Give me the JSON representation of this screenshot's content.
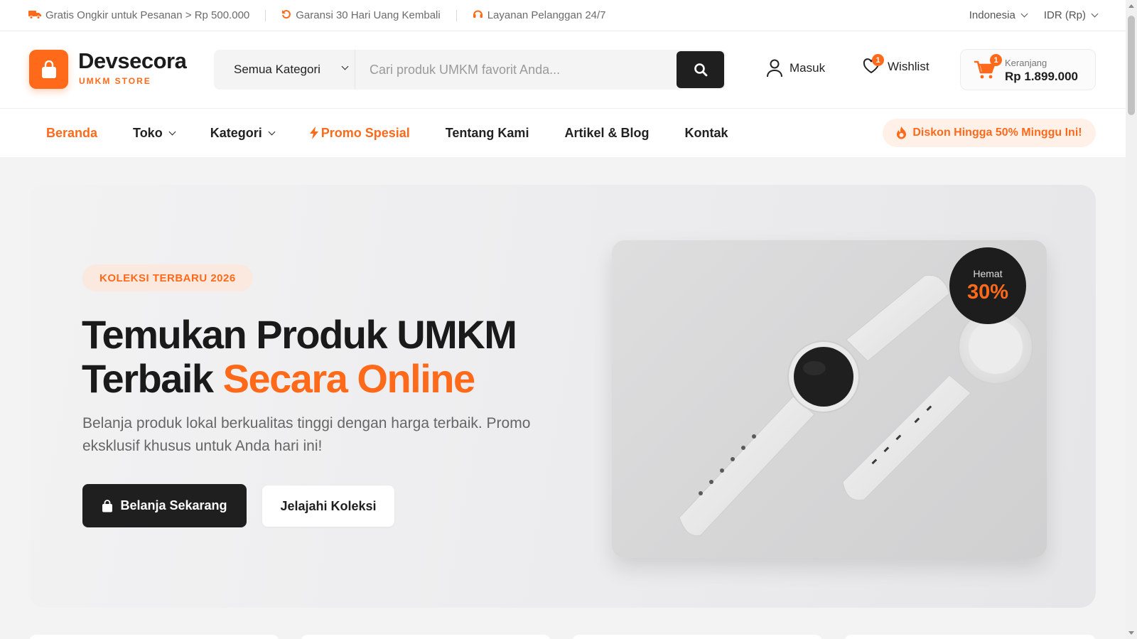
{
  "topbar": {
    "promos": [
      {
        "icon": "truck-icon",
        "text": "Gratis Ongkir untuk Pesanan > Rp 500.000"
      },
      {
        "icon": "refresh-icon",
        "text": "Garansi 30 Hari Uang Kembali"
      },
      {
        "icon": "headset-icon",
        "text": "Layanan Pelanggan 24/7"
      }
    ],
    "language": "Indonesia",
    "currency": "IDR (Rp)"
  },
  "header": {
    "logo_name": "Devsecora",
    "logo_sub": "UMKM STORE",
    "search_category": "Semua Kategori",
    "search_placeholder": "Cari produk UMKM favorit Anda...",
    "login_label": "Masuk",
    "wishlist_label": "Wishlist",
    "wishlist_count": "1",
    "cart_label": "Keranjang",
    "cart_total": "Rp 1.899.000",
    "cart_count": "1"
  },
  "nav": {
    "items": [
      {
        "label": "Beranda",
        "active": true
      },
      {
        "label": "Toko",
        "dropdown": true
      },
      {
        "label": "Kategori",
        "dropdown": true
      },
      {
        "label": "Promo Spesial",
        "icon": "lightning-icon"
      },
      {
        "label": "Tentang Kami"
      },
      {
        "label": "Artikel & Blog"
      },
      {
        "label": "Kontak"
      }
    ],
    "promo_pill": "Diskon Hingga 50% Minggu Ini!"
  },
  "hero": {
    "tag": "KOLEKSI TERBARU 2026",
    "title_line1": "Temukan Produk UMKM",
    "title_line2_plain": "Terbaik ",
    "title_line2_highlight": "Secara Online",
    "description": "Belanja produk lokal berkualitas tinggi dengan harga terbaik. Promo eksklusif khusus untuk Anda hari ini!",
    "primary_button": "Belanja Sekarang",
    "secondary_button": "Jelajahi Koleksi",
    "save_label": "Hemat",
    "save_value": "30%"
  },
  "colors": {
    "accent": "#ff6a1a",
    "dark": "#1f1f1f"
  }
}
